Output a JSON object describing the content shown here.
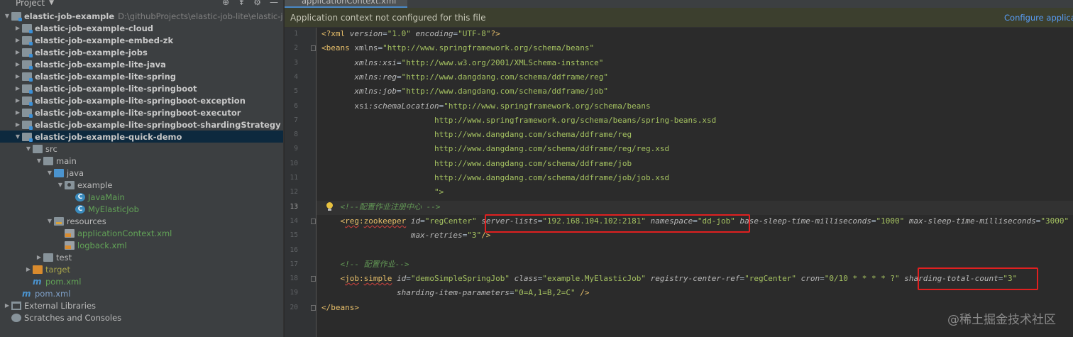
{
  "project_panel": {
    "title": "Project",
    "tree": [
      {
        "label": "elastic-job-example",
        "path": "D:\\githubProjects\\elastic-job-lite\\elastic-job-example",
        "icon": "module-icon",
        "indent": 0,
        "arrow": "expanded",
        "bold": true
      },
      {
        "label": "elastic-job-example-cloud",
        "icon": "module-icon",
        "indent": 1,
        "arrow": "collapsed",
        "bold": true
      },
      {
        "label": "elastic-job-example-embed-zk",
        "icon": "module-icon",
        "indent": 1,
        "arrow": "collapsed",
        "bold": true
      },
      {
        "label": "elastic-job-example-jobs",
        "icon": "module-icon",
        "indent": 1,
        "arrow": "collapsed",
        "bold": true
      },
      {
        "label": "elastic-job-example-lite-java",
        "icon": "module-icon",
        "indent": 1,
        "arrow": "collapsed",
        "bold": true
      },
      {
        "label": "elastic-job-example-lite-spring",
        "icon": "module-icon",
        "indent": 1,
        "arrow": "collapsed",
        "bold": true
      },
      {
        "label": "elastic-job-example-lite-springboot",
        "icon": "module-icon",
        "indent": 1,
        "arrow": "collapsed",
        "bold": true
      },
      {
        "label": "elastic-job-example-lite-springboot-exception",
        "icon": "module-icon",
        "indent": 1,
        "arrow": "collapsed",
        "bold": true
      },
      {
        "label": "elastic-job-example-lite-springboot-executor",
        "icon": "module-icon",
        "indent": 1,
        "arrow": "collapsed",
        "bold": true
      },
      {
        "label": "elastic-job-example-lite-springboot-shardingStrategy",
        "icon": "module-icon",
        "indent": 1,
        "arrow": "collapsed",
        "bold": true
      },
      {
        "label": "elastic-job-example-quick-demo",
        "icon": "module-icon",
        "indent": 1,
        "arrow": "expanded",
        "bold": true,
        "selected": true
      },
      {
        "label": "src",
        "icon": "folder-icon",
        "indent": 2,
        "arrow": "expanded"
      },
      {
        "label": "main",
        "icon": "folder-icon",
        "indent": 3,
        "arrow": "expanded"
      },
      {
        "label": "java",
        "icon": "source-folder-icon",
        "indent": 4,
        "arrow": "expanded"
      },
      {
        "label": "example",
        "icon": "package-icon",
        "indent": 5,
        "arrow": "expanded"
      },
      {
        "label": "JavaMain",
        "icon": "class-icon",
        "indent": 6,
        "arrow": "none",
        "color": "green"
      },
      {
        "label": "MyElasticJob",
        "icon": "class-icon",
        "indent": 6,
        "arrow": "none",
        "color": "green"
      },
      {
        "label": "resources",
        "icon": "resources-folder-icon",
        "indent": 4,
        "arrow": "expanded"
      },
      {
        "label": "applicationContext.xml",
        "icon": "xml-file-icon",
        "indent": 5,
        "arrow": "none",
        "color": "green"
      },
      {
        "label": "logback.xml",
        "icon": "xml-file-icon",
        "indent": 5,
        "arrow": "none",
        "color": "green"
      },
      {
        "label": "test",
        "icon": "folder-icon",
        "indent": 3,
        "arrow": "collapsed"
      },
      {
        "label": "target",
        "icon": "excluded-folder-icon",
        "indent": 2,
        "arrow": "collapsed",
        "color": "olive"
      },
      {
        "label": "pom.xml",
        "icon": "maven-icon",
        "indent": 2,
        "arrow": "none",
        "color": "green"
      },
      {
        "label": "pom.xml",
        "icon": "maven-icon",
        "indent": 1,
        "arrow": "none",
        "color": "blue"
      },
      {
        "label": "External Libraries",
        "icon": "library-icon",
        "indent": 0,
        "arrow": "collapsed"
      },
      {
        "label": "Scratches and Consoles",
        "icon": "scratch-icon",
        "indent": 0,
        "arrow": "none"
      }
    ]
  },
  "editor": {
    "tab_label": "applicationContext.xml",
    "banner_text": "Application context not configured for this file",
    "banner_link": "Configure application context",
    "current_line": 13,
    "line_numbers": [
      "1",
      "2",
      "3",
      "4",
      "5",
      "6",
      "7",
      "8",
      "9",
      "10",
      "11",
      "12",
      "13",
      "14",
      "15",
      "16",
      "17",
      "18",
      "19",
      "20"
    ],
    "lines": [
      [
        {
          "t": "<?xml ",
          "c": "pi"
        },
        {
          "t": "version",
          "c": "attr-i"
        },
        {
          "t": "=",
          "c": "plain"
        },
        {
          "t": "\"1.0\"",
          "c": "str"
        },
        {
          "t": " encoding",
          "c": "attr-i"
        },
        {
          "t": "=",
          "c": "plain"
        },
        {
          "t": "\"UTF-8\"",
          "c": "str"
        },
        {
          "t": "?>",
          "c": "pi"
        }
      ],
      [
        {
          "t": "<beans ",
          "c": "tag"
        },
        {
          "t": "xmlns",
          "c": "attr"
        },
        {
          "t": "=",
          "c": "plain"
        },
        {
          "t": "\"http://www.springframework.org/schema/beans\"",
          "c": "str"
        }
      ],
      [
        {
          "t": "       xmlns",
          "c": "attr-i"
        },
        {
          "t": ":xsi",
          "c": "attr-i"
        },
        {
          "t": "=",
          "c": "plain"
        },
        {
          "t": "\"http://www.w3.org/2001/XMLSchema-instance\"",
          "c": "str"
        }
      ],
      [
        {
          "t": "       xmlns",
          "c": "attr-i"
        },
        {
          "t": ":reg",
          "c": "attr-i"
        },
        {
          "t": "=",
          "c": "plain"
        },
        {
          "t": "\"http://www.dangdang.com/schema/ddframe/reg\"",
          "c": "str"
        }
      ],
      [
        {
          "t": "       xmlns",
          "c": "attr-i"
        },
        {
          "t": ":job",
          "c": "attr-i"
        },
        {
          "t": "=",
          "c": "plain"
        },
        {
          "t": "\"http://www.dangdang.com/schema/ddframe/job\"",
          "c": "str"
        }
      ],
      [
        {
          "t": "       xsi",
          "c": "attr"
        },
        {
          "t": ":schemaLocation",
          "c": "attr-i"
        },
        {
          "t": "=",
          "c": "plain"
        },
        {
          "t": "\"http://www.springframework.org/schema/beans",
          "c": "str"
        }
      ],
      [
        {
          "t": "                        http://www.springframework.org/schema/beans/spring-beans.xsd",
          "c": "str"
        }
      ],
      [
        {
          "t": "                        http://www.dangdang.com/schema/ddframe/reg",
          "c": "str"
        }
      ],
      [
        {
          "t": "                        http://www.dangdang.com/schema/ddframe/reg/reg.xsd",
          "c": "str"
        }
      ],
      [
        {
          "t": "                        http://www.dangdang.com/schema/ddframe/job",
          "c": "str"
        }
      ],
      [
        {
          "t": "                        http://www.dangdang.com/schema/ddframe/job/job.xsd",
          "c": "str"
        }
      ],
      [
        {
          "t": "                        \">",
          "c": "str"
        }
      ],
      [
        {
          "t": "    <!--配置作业注册中心 -->",
          "c": "cmt"
        }
      ],
      [
        {
          "t": "    <",
          "c": "tag"
        },
        {
          "t": "reg",
          "c": "tag-u"
        },
        {
          "t": ":",
          "c": "tag"
        },
        {
          "t": "zookeeper",
          "c": "tag-u"
        },
        {
          "t": " id",
          "c": "attr-i"
        },
        {
          "t": "=",
          "c": "plain"
        },
        {
          "t": "\"regCenter\"",
          "c": "str"
        },
        {
          "t": " server-lists",
          "c": "attr-i"
        },
        {
          "t": "=",
          "c": "plain"
        },
        {
          "t": "\"192.168.104.102:2181\"",
          "c": "str"
        },
        {
          "t": " namespace",
          "c": "attr-i"
        },
        {
          "t": "=",
          "c": "plain"
        },
        {
          "t": "\"dd-job\"",
          "c": "str"
        },
        {
          "t": " base-sleep-time-milliseconds",
          "c": "attr-i"
        },
        {
          "t": "=",
          "c": "plain"
        },
        {
          "t": "\"1000\"",
          "c": "str"
        },
        {
          "t": " max-sleep-time-milliseconds",
          "c": "attr-i"
        },
        {
          "t": "=",
          "c": "plain"
        },
        {
          "t": "\"3000\"",
          "c": "str"
        }
      ],
      [
        {
          "t": "                   max-retries",
          "c": "attr-i"
        },
        {
          "t": "=",
          "c": "plain"
        },
        {
          "t": "\"3\"",
          "c": "str"
        },
        {
          "t": "/>",
          "c": "tag"
        }
      ],
      [
        {
          "t": "",
          "c": "plain"
        }
      ],
      [
        {
          "t": "    <!-- 配置作业-->",
          "c": "cmt"
        }
      ],
      [
        {
          "t": "    <",
          "c": "tag"
        },
        {
          "t": "job",
          "c": "tag-u"
        },
        {
          "t": ":",
          "c": "tag"
        },
        {
          "t": "simple",
          "c": "tag-u"
        },
        {
          "t": " id",
          "c": "attr-i"
        },
        {
          "t": "=",
          "c": "plain"
        },
        {
          "t": "\"demoSimpleSpringJob\"",
          "c": "str"
        },
        {
          "t": " class",
          "c": "attr-i"
        },
        {
          "t": "=",
          "c": "plain"
        },
        {
          "t": "\"example.MyElasticJob\"",
          "c": "str"
        },
        {
          "t": " registry-center-ref",
          "c": "attr-i"
        },
        {
          "t": "=",
          "c": "plain"
        },
        {
          "t": "\"regCenter\"",
          "c": "str"
        },
        {
          "t": " cron",
          "c": "attr-i"
        },
        {
          "t": "=",
          "c": "plain"
        },
        {
          "t": "\"0/10 * * * * ?\"",
          "c": "str"
        },
        {
          "t": " sharding-total-count",
          "c": "attr-i"
        },
        {
          "t": "=",
          "c": "plain"
        },
        {
          "t": "\"3\"",
          "c": "str"
        }
      ],
      [
        {
          "t": "                sharding-item-parameters",
          "c": "attr-i"
        },
        {
          "t": "=",
          "c": "plain"
        },
        {
          "t": "\"0=A,1=B,2=C\"",
          "c": "str"
        },
        {
          "t": " />",
          "c": "tag"
        }
      ],
      [
        {
          "t": "</beans>",
          "c": "tag"
        }
      ]
    ]
  },
  "watermark": "@稀土掘金技术社区",
  "colors": {
    "highlight_box": "#e02020",
    "selection": "#0d293e",
    "link": "#589df6"
  }
}
